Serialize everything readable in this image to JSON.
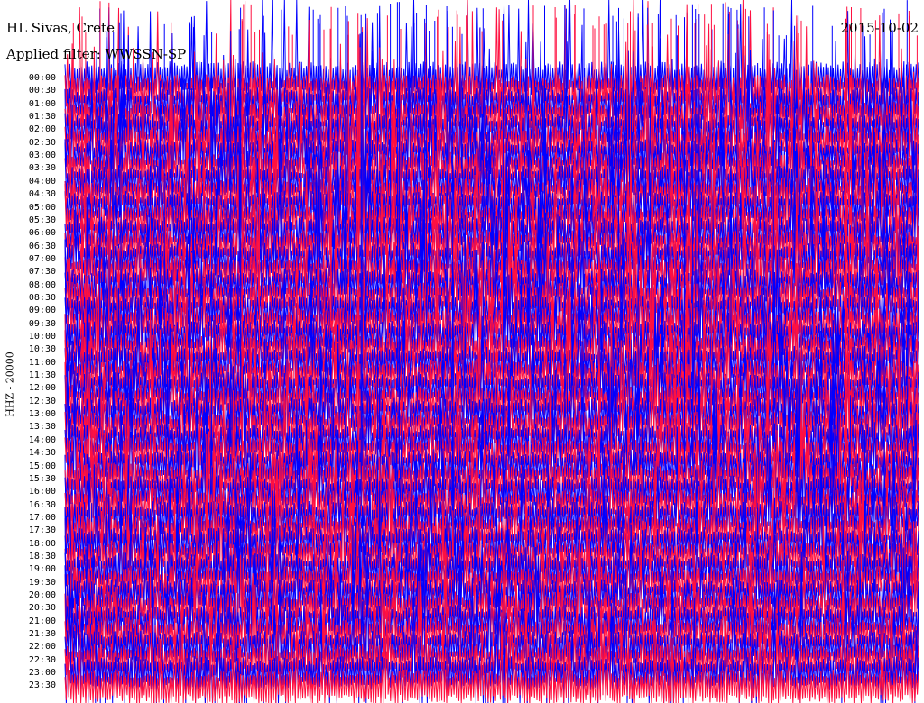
{
  "header": {
    "station": "HL Sivas, Crete",
    "date": "2015-10-02",
    "filter_label": "Applied filter: WWSSN-SP"
  },
  "colors": {
    "trace_a": "#0000ff",
    "trace_b": "#ff1040",
    "background": "#ffffff"
  },
  "chart_data": {
    "type": "line",
    "title": "HL Sivas, Crete",
    "subtitle": "Applied filter: WWSSN-SP",
    "ylabel": "HHZ - 20000",
    "xlabel": "",
    "row_interval_minutes": 30,
    "row_colors_alternate": [
      "blue",
      "red"
    ],
    "y_tick_labels": [
      "00:00",
      "00:30",
      "01:00",
      "01:30",
      "02:00",
      "02:30",
      "03:00",
      "03:30",
      "04:00",
      "04:30",
      "05:00",
      "05:30",
      "06:00",
      "06:30",
      "07:00",
      "07:30",
      "08:00",
      "08:30",
      "09:00",
      "09:30",
      "10:00",
      "10:30",
      "11:00",
      "11:30",
      "12:00",
      "12:30",
      "13:00",
      "13:30",
      "14:00",
      "14:30",
      "15:00",
      "15:30",
      "16:00",
      "16:30",
      "17:00",
      "17:30",
      "18:00",
      "18:30",
      "19:00",
      "19:30",
      "20:00",
      "20:30",
      "21:00",
      "21:30",
      "22:00",
      "22:30",
      "23:00",
      "23:30"
    ],
    "series": [
      {
        "values": [
          {
            "row": "00:00",
            "amplitude": "saturated"
          },
          {
            "row": "00:30",
            "amplitude": "saturated"
          },
          {
            "row": "01:00",
            "amplitude": "saturated"
          },
          {
            "row": "01:30",
            "amplitude": "saturated"
          },
          {
            "row": "02:00",
            "amplitude": "saturated"
          },
          {
            "row": "02:30",
            "amplitude": "saturated"
          },
          {
            "row": "03:00",
            "amplitude": "saturated"
          },
          {
            "row": "03:30",
            "amplitude": "saturated"
          },
          {
            "row": "04:00",
            "amplitude": "saturated"
          },
          {
            "row": "04:30",
            "amplitude": "saturated"
          },
          {
            "row": "05:00",
            "amplitude": "saturated"
          },
          {
            "row": "05:30",
            "amplitude": "saturated"
          },
          {
            "row": "06:00",
            "amplitude": "saturated"
          },
          {
            "row": "06:30",
            "amplitude": "saturated"
          },
          {
            "row": "07:00",
            "amplitude": "saturated"
          },
          {
            "row": "07:30",
            "amplitude": "saturated"
          },
          {
            "row": "08:00",
            "amplitude": "saturated"
          },
          {
            "row": "08:30",
            "amplitude": "saturated"
          },
          {
            "row": "09:00",
            "amplitude": "saturated"
          },
          {
            "row": "09:30",
            "amplitude": "saturated"
          },
          {
            "row": "10:00",
            "amplitude": "saturated"
          },
          {
            "row": "10:30",
            "amplitude": "saturated"
          },
          {
            "row": "11:00",
            "amplitude": "saturated"
          },
          {
            "row": "11:30",
            "amplitude": "saturated"
          },
          {
            "row": "12:00",
            "amplitude": "saturated"
          },
          {
            "row": "12:30",
            "amplitude": "saturated"
          },
          {
            "row": "13:00",
            "amplitude": "saturated"
          },
          {
            "row": "13:30",
            "amplitude": "saturated"
          },
          {
            "row": "14:00",
            "amplitude": "saturated"
          },
          {
            "row": "14:30",
            "amplitude": "saturated"
          },
          {
            "row": "15:00",
            "amplitude": "saturated"
          },
          {
            "row": "15:30",
            "amplitude": "saturated"
          },
          {
            "row": "16:00",
            "amplitude": "saturated"
          },
          {
            "row": "16:30",
            "amplitude": "saturated"
          },
          {
            "row": "17:00",
            "amplitude": "saturated"
          },
          {
            "row": "17:30",
            "amplitude": "saturated"
          },
          {
            "row": "18:00",
            "amplitude": "saturated"
          },
          {
            "row": "18:30",
            "amplitude": "saturated"
          },
          {
            "row": "19:00",
            "amplitude": "saturated"
          },
          {
            "row": "19:30",
            "amplitude": "saturated"
          },
          {
            "row": "20:00",
            "amplitude": "saturated"
          },
          {
            "row": "20:30",
            "amplitude": "saturated"
          },
          {
            "row": "21:00",
            "amplitude": "saturated"
          },
          {
            "row": "21:30",
            "amplitude": "saturated"
          },
          {
            "row": "22:00",
            "amplitude": "saturated"
          },
          {
            "row": "22:30",
            "amplitude": "saturated"
          },
          {
            "row": "23:00",
            "amplitude": "saturated"
          },
          {
            "row": "23:30",
            "amplitude": "saturated"
          }
        ]
      }
    ],
    "grid": false
  }
}
